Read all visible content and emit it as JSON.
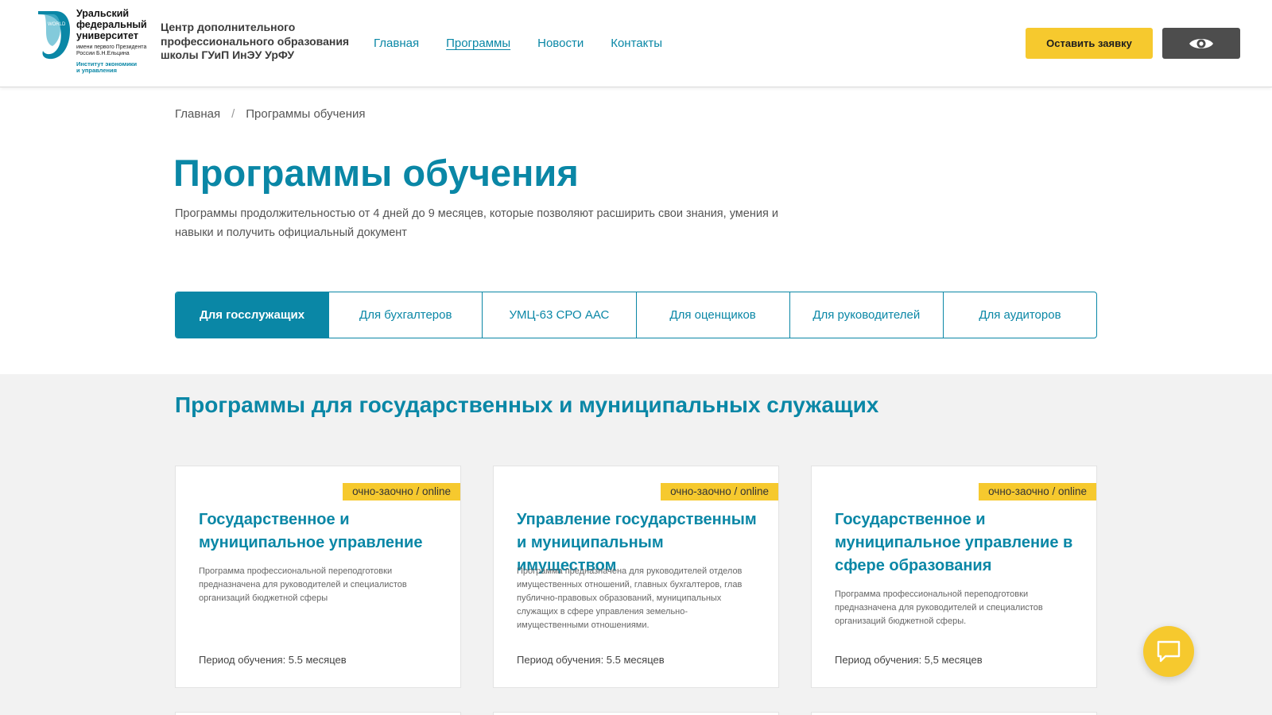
{
  "header": {
    "logo": {
      "name_lines": [
        "Уральский",
        "федеральный",
        "университет"
      ],
      "sub_lines": [
        "имени первого Президента",
        "России Б.Н.Ельцина"
      ],
      "institute_lines": [
        "Институт экономики",
        "и управления"
      ]
    },
    "center_title": "Центр дополнительного профессионального образования школы ГУиП ИнЭУ УрФУ",
    "nav": [
      {
        "label": "Главная",
        "active": false
      },
      {
        "label": "Программы",
        "active": true
      },
      {
        "label": "Новости",
        "active": false
      },
      {
        "label": "Контакты",
        "active": false
      }
    ],
    "apply_button": "Оставить заявку",
    "accessibility_icon": "eye-icon"
  },
  "breadcrumb": {
    "home": "Главная",
    "separator": "/",
    "current": "Программы обучения"
  },
  "page": {
    "title": "Программы обучения",
    "description": "Программы продолжительностью от 4 дней до 9 месяцев, которые позволяют расширить свои знания, умения и навыки и получить официальный документ"
  },
  "tabs": [
    {
      "label": "Для госслужащих",
      "active": true
    },
    {
      "label": "Для бухгалтеров",
      "active": false
    },
    {
      "label": "УМЦ-63 СРО ААС",
      "active": false
    },
    {
      "label": "Для оценщиков",
      "active": false
    },
    {
      "label": "Для руководителей",
      "active": false
    },
    {
      "label": "Для аудиторов",
      "active": false
    }
  ],
  "section": {
    "title": "Программы для государственных и муниципальных служащих"
  },
  "cards": [
    {
      "badge": "очно-заочно / online",
      "title": "Государственное и муниципальное управление",
      "description": "Программа профессиональной переподготовки предназначена для руководителей и специалистов организаций бюджетной сферы",
      "period": "Период обучения: 5.5 месяцев"
    },
    {
      "badge": "очно-заочно / online",
      "title": "Управление государственным и муниципальным имуществом",
      "description": "Программа предназначена для руководителей отделов имущественных отношений, главных бухгалтеров, глав публично-правовых образований, муниципальных служащих в сфере управления земельно-имущественными отношениями.",
      "period": "Период обучения: 5.5 месяцев"
    },
    {
      "badge": "очно-заочно / online",
      "title": "Государственное и муниципальное управление в сфере образования",
      "description": "Программа профессиональной переподготовки предназначена для руководителей и специалистов организаций бюджетной сферы.",
      "period": "Период обучения: 5,5 месяцев"
    }
  ],
  "chat": {
    "icon": "chat-icon"
  },
  "colors": {
    "accent": "#0a87a6",
    "yellow": "#f6c92e",
    "dark_button": "#4d4d4d",
    "section_bg": "#f2f2f2"
  }
}
